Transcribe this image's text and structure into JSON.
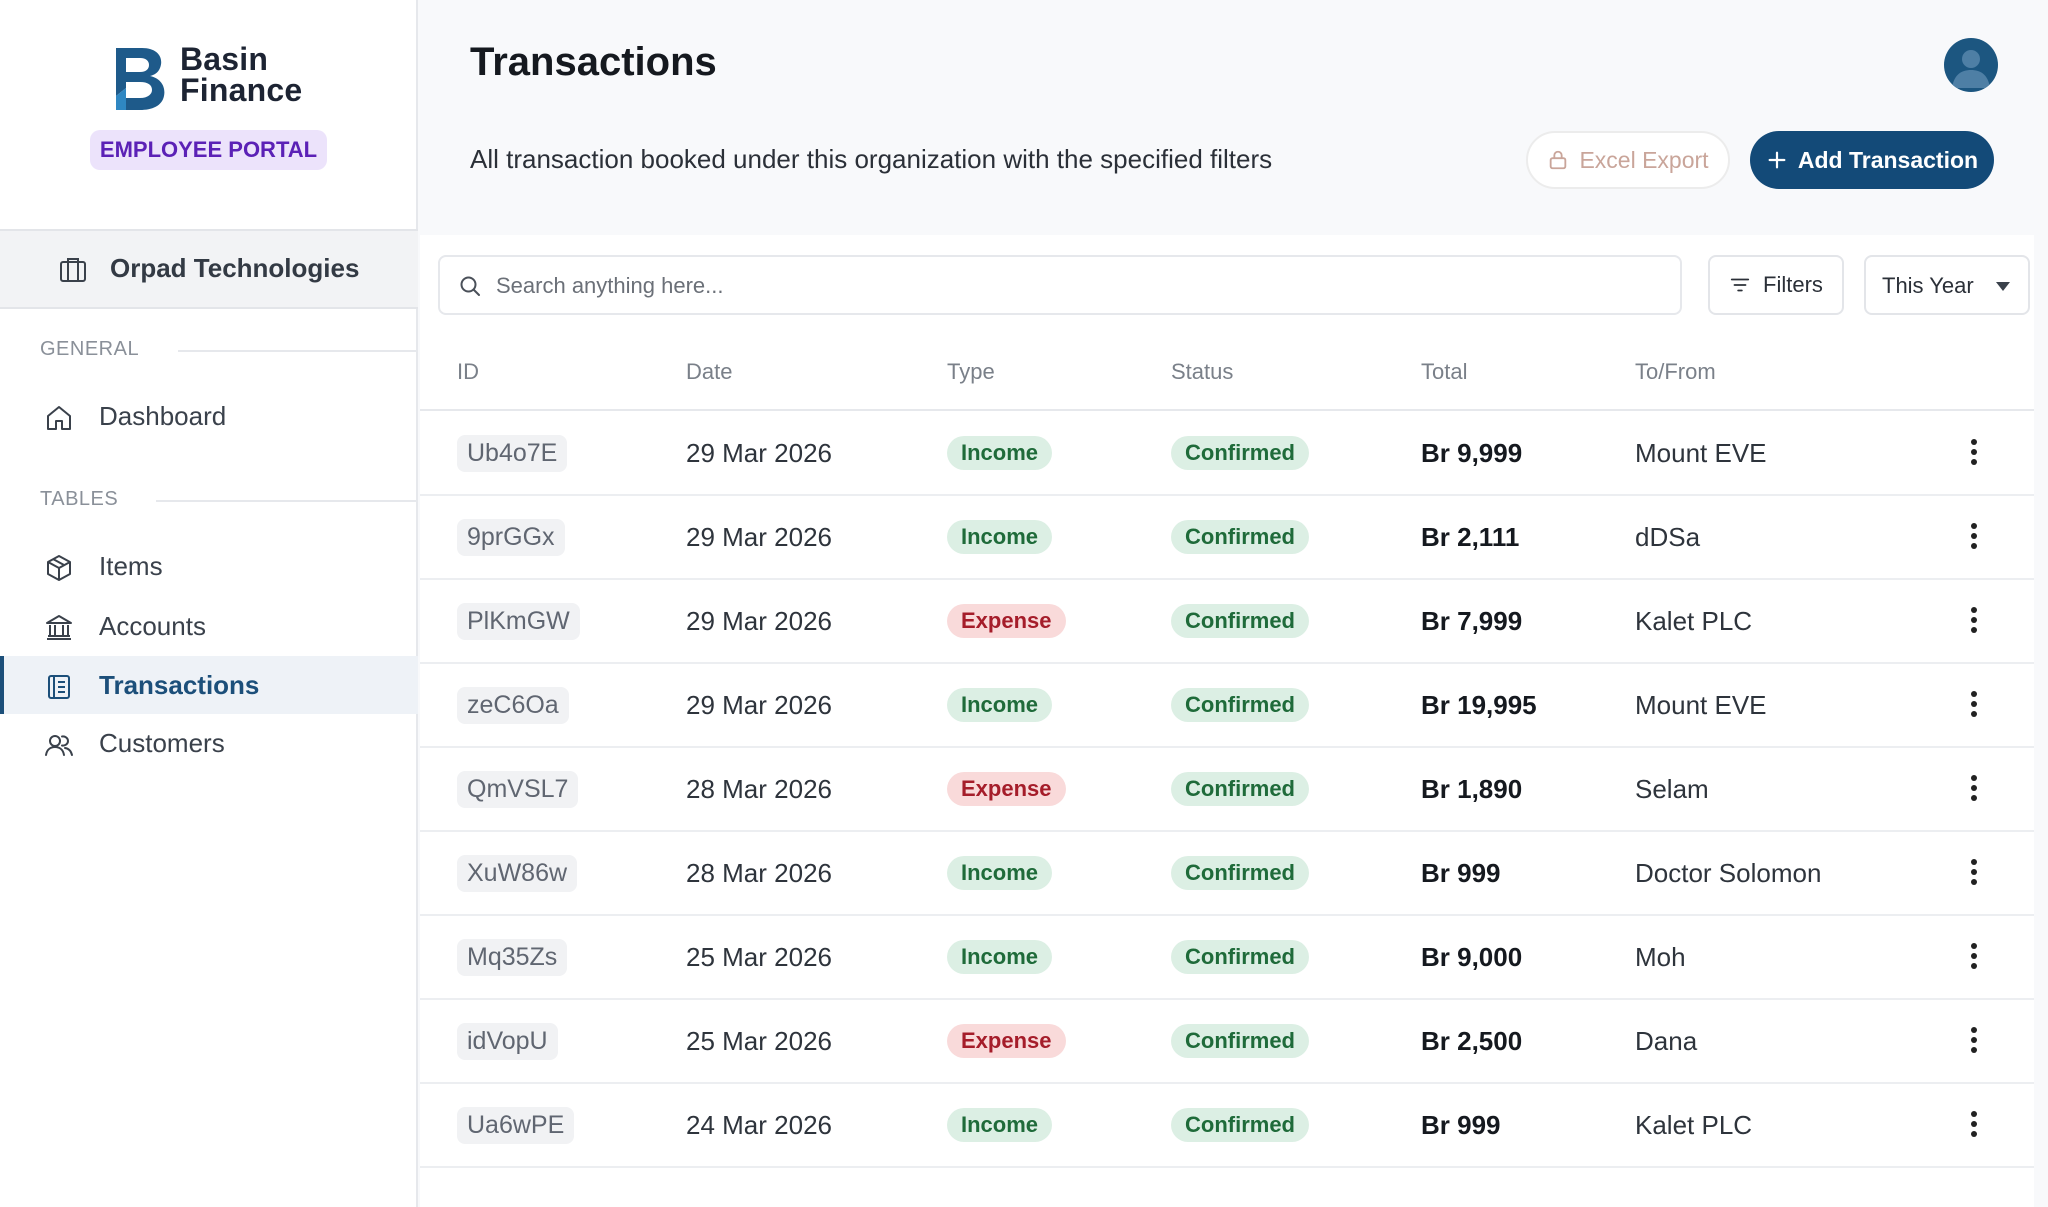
{
  "brand": {
    "name_line1": "Basin",
    "name_line2": "Finance",
    "portal_label": "EMPLOYEE PORTAL"
  },
  "organization": {
    "name": "Orpad Technologies"
  },
  "sidebar": {
    "sections": [
      {
        "title": "GENERAL",
        "items": [
          {
            "label": "Dashboard",
            "icon": "home-icon",
            "active": false
          }
        ]
      },
      {
        "title": "TABLES",
        "items": [
          {
            "label": "Items",
            "icon": "box-icon",
            "active": false
          },
          {
            "label": "Accounts",
            "icon": "bank-icon",
            "active": false
          },
          {
            "label": "Transactions",
            "icon": "ledger-icon",
            "active": true
          },
          {
            "label": "Customers",
            "icon": "users-icon",
            "active": false
          }
        ]
      }
    ]
  },
  "header": {
    "title": "Transactions",
    "subtitle": "All transaction booked under this organization with the specified filters",
    "export_label": "Excel Export",
    "add_label": "Add Transaction"
  },
  "toolbar": {
    "search_placeholder": "Search anything here...",
    "filters_label": "Filters",
    "period_value": "This Year"
  },
  "table": {
    "columns": [
      "ID",
      "Date",
      "Type",
      "Status",
      "Total",
      "To/From"
    ],
    "rows": [
      {
        "id": "Ub4o7E",
        "date": "29 Mar 2026",
        "type": "Income",
        "status": "Confirmed",
        "total": "Br 9,999",
        "party": "Mount EVE"
      },
      {
        "id": "9prGGx",
        "date": "29 Mar 2026",
        "type": "Income",
        "status": "Confirmed",
        "total": "Br 2,111",
        "party": "dDSa"
      },
      {
        "id": "PlKmGW",
        "date": "29 Mar 2026",
        "type": "Expense",
        "status": "Confirmed",
        "total": "Br 7,999",
        "party": "Kalet PLC"
      },
      {
        "id": "zeC6Oa",
        "date": "29 Mar 2026",
        "type": "Income",
        "status": "Confirmed",
        "total": "Br 19,995",
        "party": "Mount EVE"
      },
      {
        "id": "QmVSL7",
        "date": "28 Mar 2026",
        "type": "Expense",
        "status": "Confirmed",
        "total": "Br 1,890",
        "party": "Selam"
      },
      {
        "id": "XuW86w",
        "date": "28 Mar 2026",
        "type": "Income",
        "status": "Confirmed",
        "total": "Br 999",
        "party": "Doctor Solomon"
      },
      {
        "id": "Mq35Zs",
        "date": "25 Mar 2026",
        "type": "Income",
        "status": "Confirmed",
        "total": "Br 9,000",
        "party": "Moh"
      },
      {
        "id": "idVopU",
        "date": "25 Mar 2026",
        "type": "Expense",
        "status": "Confirmed",
        "total": "Br 2,500",
        "party": "Dana"
      },
      {
        "id": "Ua6wPE",
        "date": "24 Mar 2026",
        "type": "Income",
        "status": "Confirmed",
        "total": "Br 999",
        "party": "Kalet PLC"
      }
    ]
  },
  "colors": {
    "primary": "#134a78",
    "income_bg": "#dcefe4",
    "expense_bg": "#f9dada",
    "portal_bg": "#ece3fb"
  }
}
